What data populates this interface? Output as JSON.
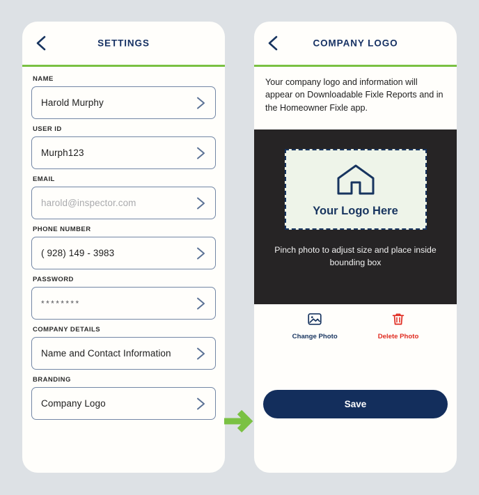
{
  "theme": {
    "background": "#dde1e5",
    "panel_bg": "#fffefb",
    "navy": "#17345f",
    "green_rule": "#7ac143",
    "arrow_green": "#7ac143",
    "photo_stage_bg": "#262425",
    "logo_box_bg": "#eef4e9",
    "delete_red": "#e02b20",
    "save_bg": "#132e5c"
  },
  "settings_screen": {
    "back_icon": "chevron-left-icon",
    "title": "SETTINGS",
    "fields": [
      {
        "label": "NAME",
        "value": "Harold Murphy",
        "is_placeholder": false,
        "is_password": false,
        "chevron": "chevron-right-icon"
      },
      {
        "label": "USER ID",
        "value": "Murph123",
        "is_placeholder": false,
        "is_password": false,
        "chevron": "chevron-right-icon"
      },
      {
        "label": "EMAIL",
        "value": "harold@inspector.com",
        "is_placeholder": true,
        "is_password": false,
        "chevron": "chevron-right-icon"
      },
      {
        "label": "PHONE NUMBER",
        "value": "( 928) 149 - 3983",
        "is_placeholder": false,
        "is_password": false,
        "chevron": "chevron-right-icon"
      },
      {
        "label": "PASSWORD",
        "value": "********",
        "is_placeholder": false,
        "is_password": true,
        "chevron": "chevron-right-icon"
      },
      {
        "label": "COMPANY DETAILS",
        "value": "Name and Contact Information",
        "is_placeholder": false,
        "is_password": false,
        "chevron": "chevron-right-icon"
      },
      {
        "label": "BRANDING",
        "value": "Company Logo",
        "is_placeholder": false,
        "is_password": false,
        "chevron": "chevron-right-icon"
      }
    ]
  },
  "flow": {
    "arrow_icon": "arrow-right-icon"
  },
  "logo_screen": {
    "back_icon": "chevron-left-icon",
    "title": "COMPANY LOGO",
    "description": "Your company logo and information will appear on Downloadable Fixle Reports and in the Homeowner Fixle app.",
    "logo_placeholder": {
      "icon": "house-icon",
      "text": "Your Logo Here"
    },
    "pinch_instruction": "Pinch photo to adjust size and place inside bounding box",
    "actions": [
      {
        "icon": "image-icon",
        "label": "Change Photo",
        "color": "#17345f"
      },
      {
        "icon": "trash-icon",
        "label": "Delete Photo",
        "color": "#e02b20"
      }
    ],
    "save_label": "Save"
  }
}
